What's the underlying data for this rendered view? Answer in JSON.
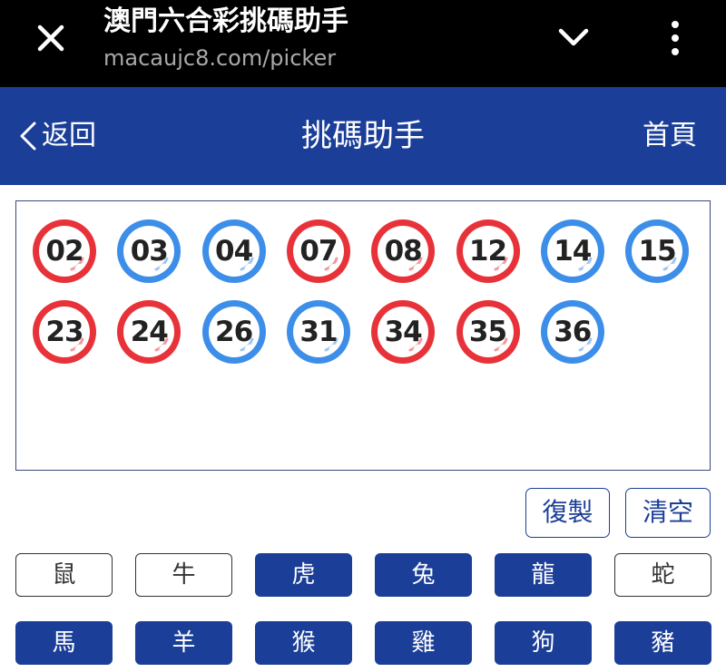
{
  "browser": {
    "title": "澳門六合彩挑碼助手",
    "url": "macaujc8.com/picker"
  },
  "header": {
    "back_label": "返回",
    "title": "挑碼助手",
    "home_label": "首頁",
    "bg_color": "#1b3e98"
  },
  "selected_numbers": [
    {
      "n": "02",
      "color": "red"
    },
    {
      "n": "03",
      "color": "blue"
    },
    {
      "n": "04",
      "color": "blue"
    },
    {
      "n": "07",
      "color": "red"
    },
    {
      "n": "08",
      "color": "red"
    },
    {
      "n": "12",
      "color": "red"
    },
    {
      "n": "14",
      "color": "blue"
    },
    {
      "n": "15",
      "color": "blue"
    },
    {
      "n": "23",
      "color": "red"
    },
    {
      "n": "24",
      "color": "red"
    },
    {
      "n": "26",
      "color": "blue"
    },
    {
      "n": "31",
      "color": "blue"
    },
    {
      "n": "34",
      "color": "red"
    },
    {
      "n": "35",
      "color": "red"
    },
    {
      "n": "36",
      "color": "blue"
    }
  ],
  "ball_colors": {
    "red": "#e8323a",
    "blue": "#3d8ee8"
  },
  "actions": {
    "copy_label": "復製",
    "clear_label": "清空"
  },
  "zodiacs": [
    {
      "label": "鼠",
      "active": false
    },
    {
      "label": "牛",
      "active": false
    },
    {
      "label": "虎",
      "active": true
    },
    {
      "label": "兔",
      "active": true
    },
    {
      "label": "龍",
      "active": true
    },
    {
      "label": "蛇",
      "active": false
    },
    {
      "label": "馬",
      "active": true
    },
    {
      "label": "羊",
      "active": true
    },
    {
      "label": "猴",
      "active": true
    },
    {
      "label": "雞",
      "active": true
    },
    {
      "label": "狗",
      "active": true
    },
    {
      "label": "豬",
      "active": true
    }
  ]
}
